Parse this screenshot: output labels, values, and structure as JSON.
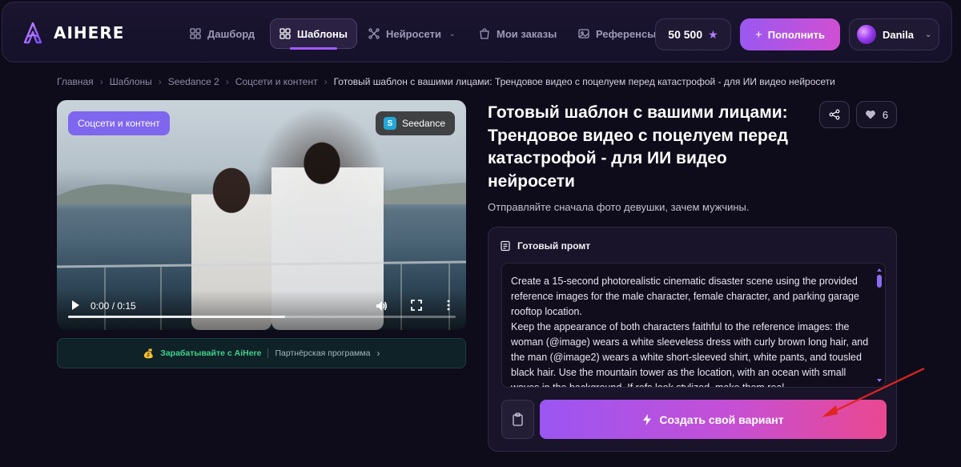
{
  "header": {
    "logo_text": "AIHERE",
    "nav": [
      {
        "label": "Дашборд",
        "icon": "dashboard-icon"
      },
      {
        "label": "Шаблоны",
        "icon": "templates-grid-icon",
        "active": true
      },
      {
        "label": "Нейросети",
        "icon": "network-icon",
        "has_dropdown": true
      },
      {
        "label": "Мои заказы",
        "icon": "bag-icon"
      },
      {
        "label": "Референсы",
        "icon": "image-icon"
      }
    ],
    "balance": "50 500",
    "topup_label": "Пополнить",
    "user_name": "Danila"
  },
  "breadcrumb": [
    "Главная",
    "Шаблоны",
    "Seedance 2",
    "Соцсети и контент",
    "Готовый шаблон с вашими лицами: Трендовое видео с поцелуем перед катастрофой - для ИИ видео нейросети"
  ],
  "video": {
    "category_tag": "Соцсети и контент",
    "model_tag": "Seedance",
    "model_tag_icon_letter": "S",
    "time": "0:00 / 0:15",
    "progress": 0.56
  },
  "affiliate": {
    "earn_label": "Зарабатывайте с AiHere",
    "partner_label": "Партнёрская программа"
  },
  "template": {
    "title": "Готовый шаблон с вашими лицами: Трендовое видео с поцелуем перед катастрофой - для ИИ видео нейросети",
    "likes": "6",
    "subtitle": "Отправляйте сначала фото девушки, зачем мужчины.",
    "prompt_heading": "Готовый промт",
    "prompt_text": "Create a 15-second photorealistic cinematic disaster scene using the provided reference images for the male character, female character, and parking garage rooftop location.\nKeep the appearance of both characters faithful to the reference images: the woman (@image) wears a white sleeveless dress with curly brown long hair, and the man (@image2) wears a white short-sleeved shirt, white pants, and tousled black hair. Use the mountain tower as the location, with an ocean with small waves in the background. If refs look stylized, make them real.",
    "create_label": "Создать свой вариант"
  },
  "colors": {
    "accent": "#9b56f3",
    "accent_end": "#ea4890",
    "earn_green": "#41d08a",
    "annotation_arrow": "#e0241f"
  }
}
